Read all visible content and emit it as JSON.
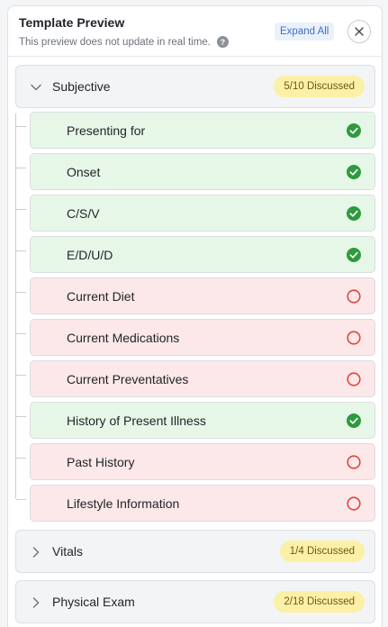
{
  "header": {
    "title": "Template Preview",
    "subtitle": "This preview does not update in real time.",
    "help_icon": "question-circle-icon",
    "expand_label": "Expand All",
    "close_icon": "close-icon"
  },
  "colors": {
    "discussed_bg": "#e6f7e8",
    "not_discussed_bg": "#fce8e8",
    "check": "#2e9a3e",
    "pending_ring": "#e0453f",
    "badge_bg": "#fbf0a6",
    "expand_text": "#3b6fc4"
  },
  "sections": [
    {
      "label": "Subjective",
      "badge": "5/10 Discussed",
      "expanded": true,
      "items": [
        {
          "label": "Presenting for",
          "status": "discussed"
        },
        {
          "label": "Onset",
          "status": "discussed"
        },
        {
          "label": "C/S/V",
          "status": "discussed"
        },
        {
          "label": "E/D/U/D",
          "status": "discussed"
        },
        {
          "label": "Current Diet",
          "status": "not-discussed"
        },
        {
          "label": "Current Medications",
          "status": "not-discussed"
        },
        {
          "label": "Current Preventatives",
          "status": "not-discussed"
        },
        {
          "label": "History of Present Illness",
          "status": "discussed"
        },
        {
          "label": "Past History",
          "status": "not-discussed"
        },
        {
          "label": "Lifestyle Information",
          "status": "not-discussed"
        }
      ]
    },
    {
      "label": "Vitals",
      "badge": "1/4 Discussed",
      "expanded": false
    },
    {
      "label": "Physical Exam",
      "badge": "2/18 Discussed",
      "expanded": false
    }
  ]
}
